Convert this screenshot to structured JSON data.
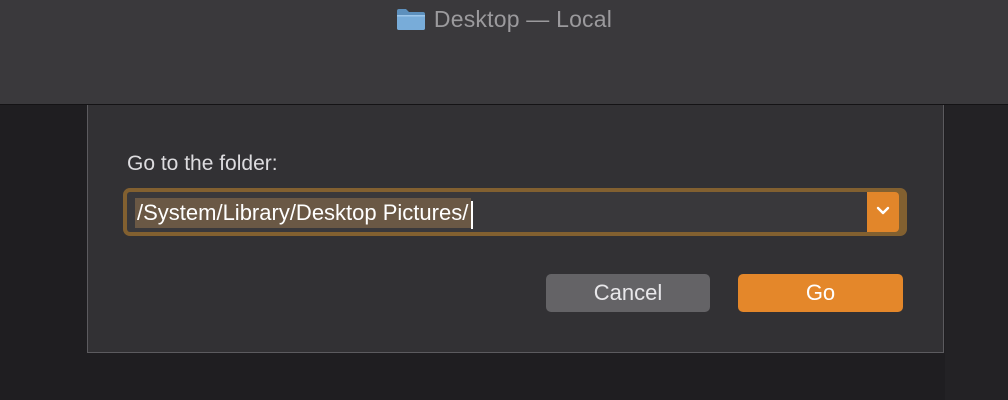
{
  "window": {
    "title": "Desktop — Local",
    "title_icon": "folder-icon"
  },
  "dialog": {
    "prompt_label": "Go to the folder:",
    "path_value": "/System/Library/Desktop Pictures/",
    "dropdown_icon": "chevron-down-icon",
    "cancel_label": "Cancel",
    "go_label": "Go"
  },
  "colors": {
    "accent": "#e4872a",
    "focus_ring": "#826030",
    "selection": "#6a5845"
  }
}
